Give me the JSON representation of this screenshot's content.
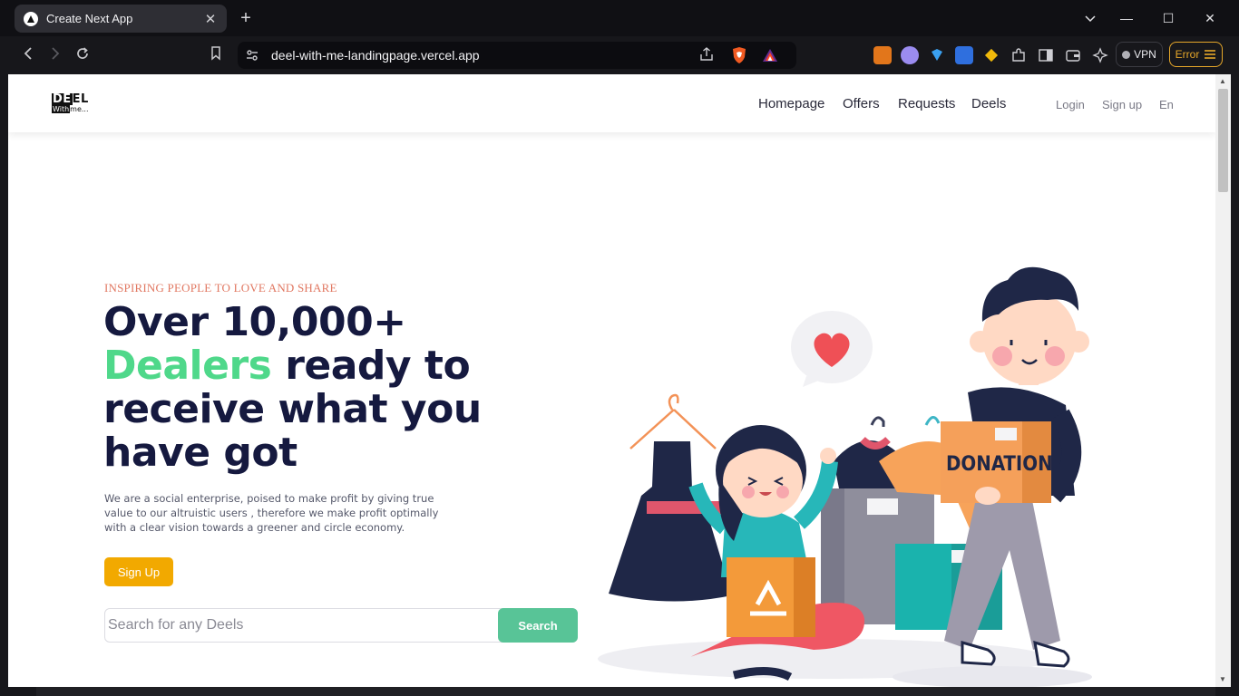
{
  "browser": {
    "tab": {
      "title": "Create Next App",
      "close": "✕"
    },
    "new_tab": "+",
    "window_controls": {
      "dropdown": "⌄",
      "minimize": "—",
      "maximize": "☐",
      "close": "✕"
    },
    "url": "deel-with-me-landingpage.vercel.app",
    "vpn_label": "VPN",
    "error_label": "Error"
  },
  "site": {
    "logo": {
      "line1_box": "DE",
      "line1_rest": "EL",
      "line2_box": "With",
      "line2_rest": "me..."
    },
    "nav": [
      "Homepage",
      "Offers",
      "Requests",
      "Deels"
    ],
    "auth": {
      "login": "Login",
      "signup": "Sign up",
      "lang": "En"
    },
    "hero": {
      "eyebrow": "INSPIRING PEOPLE TO LOVE AND SHARE",
      "line1": "Over 10,000+",
      "accent": "Dealers",
      "line2_rest": " ready to",
      "line3": "receive what you",
      "line4": "have got",
      "description": "We are a social enterprise, poised to make profit by giving true value to our altruistic users , therefore we make profit optimally with a clear vision towards a greener and circle economy.",
      "cta": "Sign Up",
      "search_placeholder": "Search for any Deels",
      "search_button": "Search"
    },
    "illustration": {
      "box_label": "DONATION"
    }
  },
  "colors": {
    "accent_green": "#4fd88a",
    "headline_navy": "#15193f",
    "eyebrow_coral": "#e17862",
    "cta_yellow": "#f2a900",
    "search_green": "#58c497",
    "error_amber": "#e6a72a"
  }
}
